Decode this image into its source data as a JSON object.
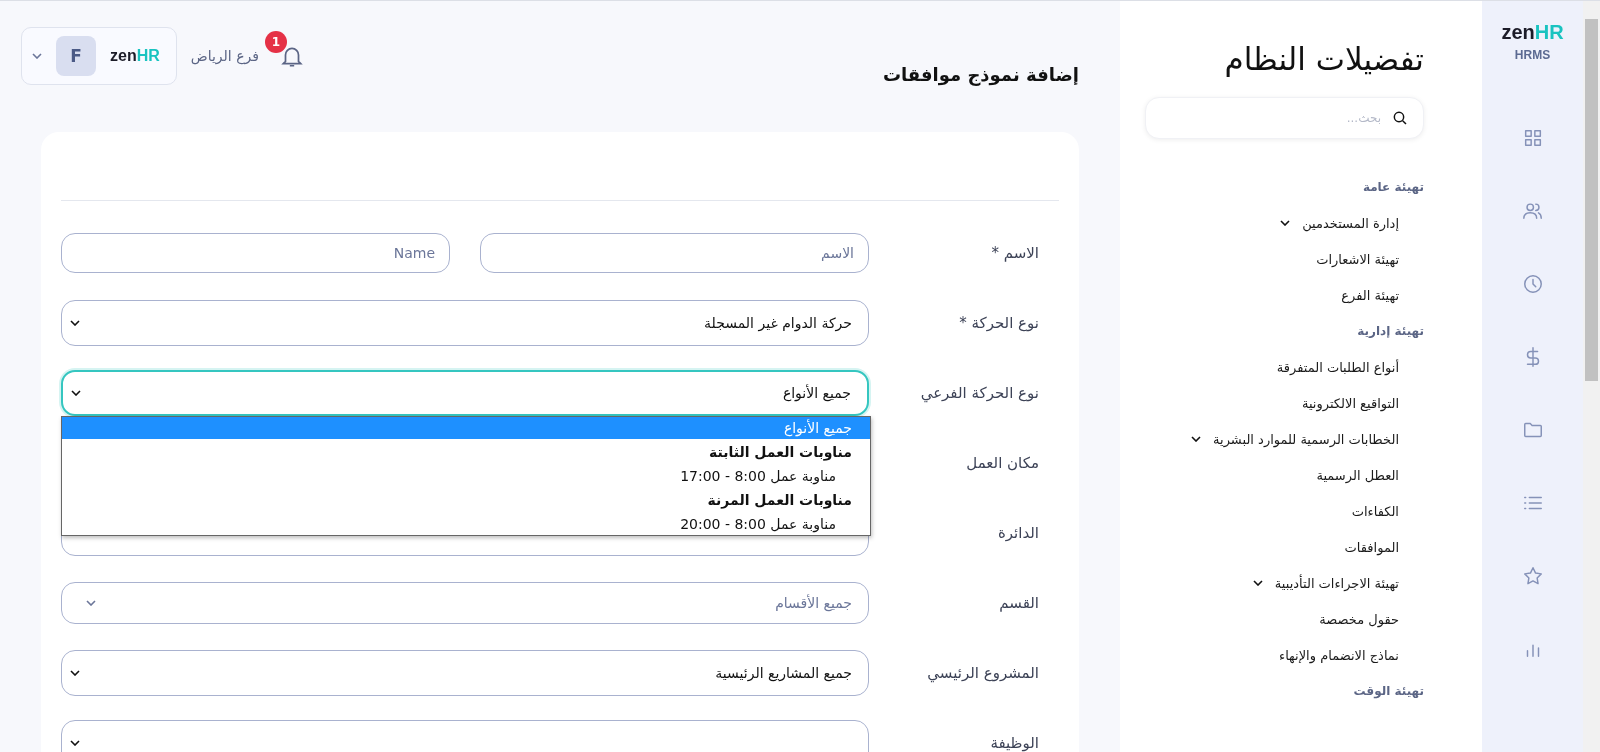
{
  "header": {
    "branch": "فرع الرياض",
    "notifications": "1",
    "avatar": "F",
    "logo": {
      "main": "zen",
      "accent": "HR"
    }
  },
  "page_title": "إضافة نموذج موافقات",
  "form": {
    "rows": [
      {
        "kind": "text-pair",
        "label": "الاسم",
        "required_mark": "*",
        "fields": [
          {
            "placeholder": "الاسم"
          },
          {
            "placeholder": "Name"
          }
        ]
      },
      {
        "kind": "native-select",
        "label": "نوع الحركة",
        "required_mark": "*",
        "value": "حركة الدوام غير المسجلة",
        "focused": false
      },
      {
        "kind": "native-select",
        "label": "نوع الحركة الفرعي",
        "value": "جميع الأنواع",
        "focused": true,
        "open": true,
        "options": [
          {
            "kind": "option",
            "text": "جميع الأنواع",
            "selected": true
          },
          {
            "kind": "group",
            "text": "مناوبات العمل الثابتة"
          },
          {
            "kind": "option",
            "text": "مناوبة عمل 8:00 - 17:00",
            "selected": false
          },
          {
            "kind": "group",
            "text": "مناوبات العمل المرنة"
          },
          {
            "kind": "option",
            "text": "مناوبة عمل 8:00 - 20:00",
            "selected": false
          }
        ]
      },
      {
        "kind": "hidden",
        "label": "مكان العمل"
      },
      {
        "kind": "covered",
        "label": "الدائرة"
      },
      {
        "kind": "select",
        "label": "القسم",
        "placeholder": "جميع الأقسام"
      },
      {
        "kind": "native-select",
        "label": "المشروع الرئيسي",
        "value": "جميع المشاريع الرئيسية",
        "focused": false
      },
      {
        "kind": "native-select",
        "label": "الوظيفة",
        "focused": false
      }
    ]
  },
  "settings": {
    "title": "تفضيلات النظام",
    "search_placeholder": "بحث...",
    "items": [
      {
        "kind": "heading",
        "text": "تهيئة عامة"
      },
      {
        "kind": "item",
        "text": "إدارة المستخدمين",
        "expandable": true
      },
      {
        "kind": "item",
        "text": "تهيئة الاشعارات",
        "expandable": false
      },
      {
        "kind": "item",
        "text": "تهيئة الفرع",
        "expandable": false
      },
      {
        "kind": "heading",
        "text": "تهيئة إدارية"
      },
      {
        "kind": "item",
        "text": "أنواع الطلبات المتفرقة",
        "expandable": false
      },
      {
        "kind": "item",
        "text": "التواقيع الالكترونية",
        "expandable": false
      },
      {
        "kind": "item",
        "text": "الخطابات الرسمية للموارد البشرية",
        "expandable": true
      },
      {
        "kind": "item",
        "text": "العطل الرسمية",
        "expandable": false
      },
      {
        "kind": "item",
        "text": "الكفاءات",
        "expandable": false
      },
      {
        "kind": "item",
        "text": "الموافقات",
        "expandable": false
      },
      {
        "kind": "item",
        "text": "تهيئة الاجراءات التأديبية",
        "expandable": true
      },
      {
        "kind": "item",
        "text": "حقول مخصصة",
        "expandable": false
      },
      {
        "kind": "item",
        "text": "نماذج الانضمام والإنهاء",
        "expandable": false
      },
      {
        "kind": "heading",
        "text": "تهيئة الوقت"
      }
    ]
  },
  "rail": {
    "logo": {
      "main": "zen",
      "accent": "HR"
    },
    "subtitle": "HRMS"
  }
}
